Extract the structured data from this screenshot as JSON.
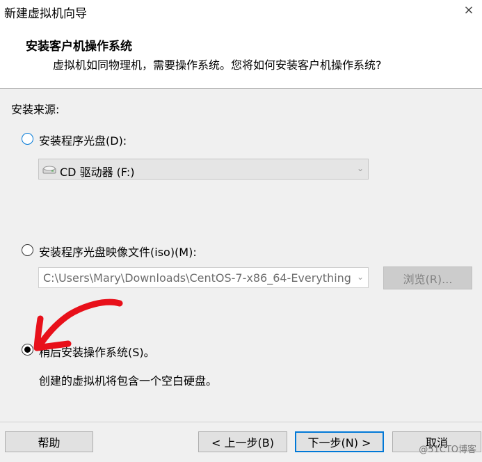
{
  "window": {
    "title": "新建虚拟机向导",
    "close_glyph": "×"
  },
  "header": {
    "title": "安装客户机操作系统",
    "subtitle": "虚拟机如同物理机，需要操作系统。您将如何安装客户机操作系统?"
  },
  "source": {
    "label": "安装来源:",
    "option_disc": {
      "label": "安装程序光盘(D):",
      "checked": false,
      "drive_value": "CD 驱动器 (F:)",
      "drive_icon": "cd-drive-icon"
    },
    "option_iso": {
      "label": "安装程序光盘映像文件(iso)(M):",
      "checked": false,
      "path_value": "C:\\Users\\Mary\\Downloads\\CentOS-7-x86_64-Everything",
      "browse_label": "浏览(R)..."
    },
    "option_later": {
      "label": "稍后安装操作系统(S)。",
      "checked": true,
      "description": "创建的虚拟机将包含一个空白硬盘。"
    }
  },
  "footer": {
    "help_label": "帮助",
    "back_label": "< 上一步(B)",
    "next_label": "下一步(N) >",
    "cancel_label": "取消"
  },
  "watermark": "@51CTO博客",
  "annotation": {
    "color": "#e8101a"
  }
}
